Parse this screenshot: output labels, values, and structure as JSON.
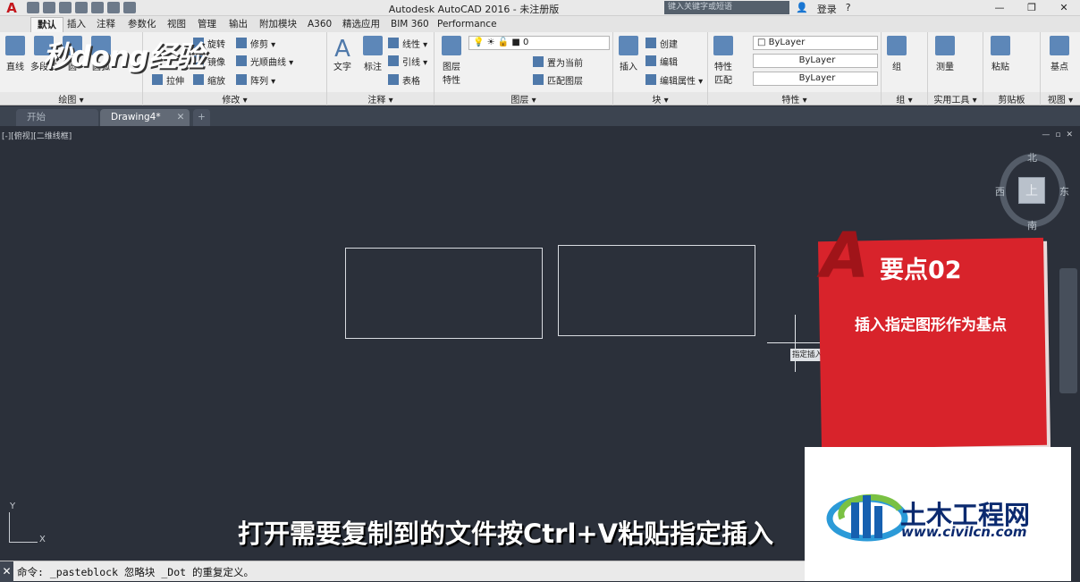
{
  "window": {
    "title": "Autodesk AutoCAD 2016 - 未注册版",
    "search_placeholder": "键入关键字或短语",
    "login_label": "登录",
    "minimize": "—",
    "restore": "❐",
    "close": "✕"
  },
  "app_logo": "A",
  "ribbon_tabs": [
    "默认",
    "插入",
    "注释",
    "参数化",
    "视图",
    "管理",
    "输出",
    "附加模块",
    "A360",
    "精选应用",
    "BIM 360",
    "Performance"
  ],
  "ribbon": {
    "draw": {
      "title": "绘图 ▾",
      "line": "直线",
      "polyline": "多段线",
      "circle": "圆",
      "arc": "圆弧"
    },
    "modify": {
      "title": "修改 ▾",
      "rotate": "旋转",
      "trim": "修剪 ▾",
      "mirror": "镜像",
      "fillet": "光顺曲线 ▾",
      "stretch": "拉伸",
      "scale": "缩放",
      "array": "阵列 ▾"
    },
    "annotation": {
      "title": "注释 ▾",
      "text": "文字",
      "dimension": "标注",
      "linear": "线性 ▾",
      "leader": "引线 ▾",
      "table": "表格"
    },
    "layers": {
      "title": "图层 ▾",
      "properties": "图层",
      "properties2": "特性",
      "layer_value": "0",
      "set_current": "置为当前",
      "match_layer": "匹配图层"
    },
    "block": {
      "title": "块 ▾",
      "insert": "插入",
      "create": "创建",
      "edit": "编辑",
      "edit_attr": "编辑属性 ▾"
    },
    "properties": {
      "title": "特性 ▾",
      "match": "特性",
      "match2": "匹配",
      "color": "ByLayer",
      "linetype": "ByLayer",
      "lineweight": "ByLayer"
    },
    "groups": {
      "title": "组 ▾",
      "group": "组"
    },
    "utilities": {
      "title": "实用工具 ▾",
      "measure": "测量"
    },
    "clipboard": {
      "title": "剪贴板",
      "paste": "粘贴"
    },
    "view": {
      "title": "视图 ▾",
      "base": "基点"
    }
  },
  "doc_tabs": [
    {
      "label": "开始"
    },
    {
      "label": "Drawing4*",
      "close": "✕"
    }
  ],
  "new_tab": "+",
  "viewport_label": "[-][俯视][二维线框]",
  "viewport_controls": [
    "—",
    "▫",
    "✕"
  ],
  "cursor_tooltip": "指定插入点",
  "viewcube": {
    "north": "北",
    "south": "南",
    "west": "西",
    "east": "东",
    "top": "上"
  },
  "ucs": {
    "x": "X",
    "y": "Y"
  },
  "overlay": {
    "watermark": "秒dong经验",
    "badge_letter": "A",
    "popup_title": "要点02",
    "popup_body": "插入指定图形作为基点",
    "subtitle": "打开需要复制到的文件按Ctrl+V粘贴指定插入",
    "site_name": "土木工程网",
    "site_url": "www.civilcn.com"
  },
  "command_line": {
    "close": "✕",
    "text": "命令: _pasteblock 忽略块 _Dot 的重复定义。"
  },
  "colors": {
    "canvas": "#2b303a",
    "popup_red": "#d8232b",
    "logo_blue": "#0b2a6f"
  }
}
